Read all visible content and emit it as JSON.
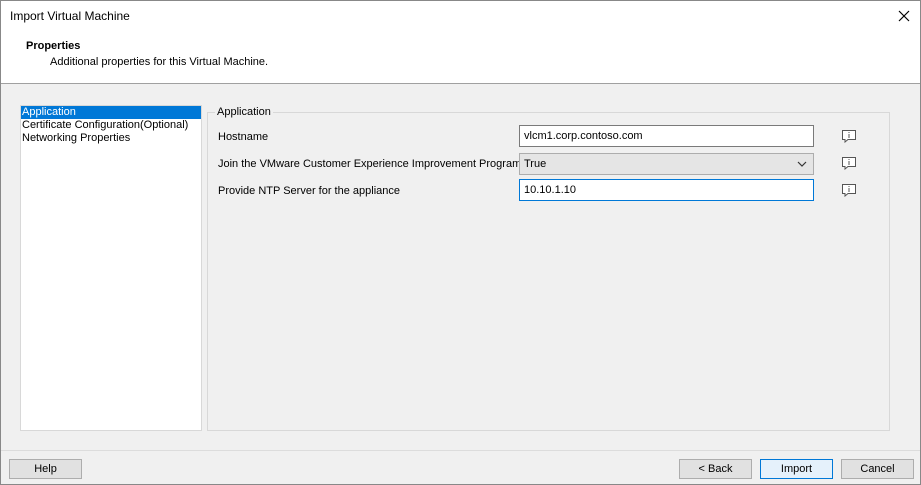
{
  "window": {
    "title": "Import Virtual Machine"
  },
  "header": {
    "title": "Properties",
    "subtitle": "Additional properties for this Virtual Machine."
  },
  "nav": {
    "items": [
      {
        "label": "Application"
      },
      {
        "label": "Certificate Configuration(Optional)"
      },
      {
        "label": "Networking Properties"
      }
    ],
    "selected_index": 0
  },
  "section": {
    "label": "Application",
    "fields": [
      {
        "label": "Hostname",
        "value": "vlcm1.corp.contoso.com"
      },
      {
        "label": "Join the VMware Customer Experience Improvement Program",
        "value": "True"
      },
      {
        "label": "Provide NTP Server for the appliance",
        "value": "10.10.1.10"
      }
    ]
  },
  "footer": {
    "help_label": "Help",
    "back_label": "< Back",
    "import_label": "Import",
    "cancel_label": "Cancel"
  },
  "icons": {
    "close": "close-icon",
    "info": "info-icon",
    "chevron": "chevron-down-icon"
  },
  "colors": {
    "accent": "#0078d7",
    "window_bg": "#f0f0f0"
  }
}
